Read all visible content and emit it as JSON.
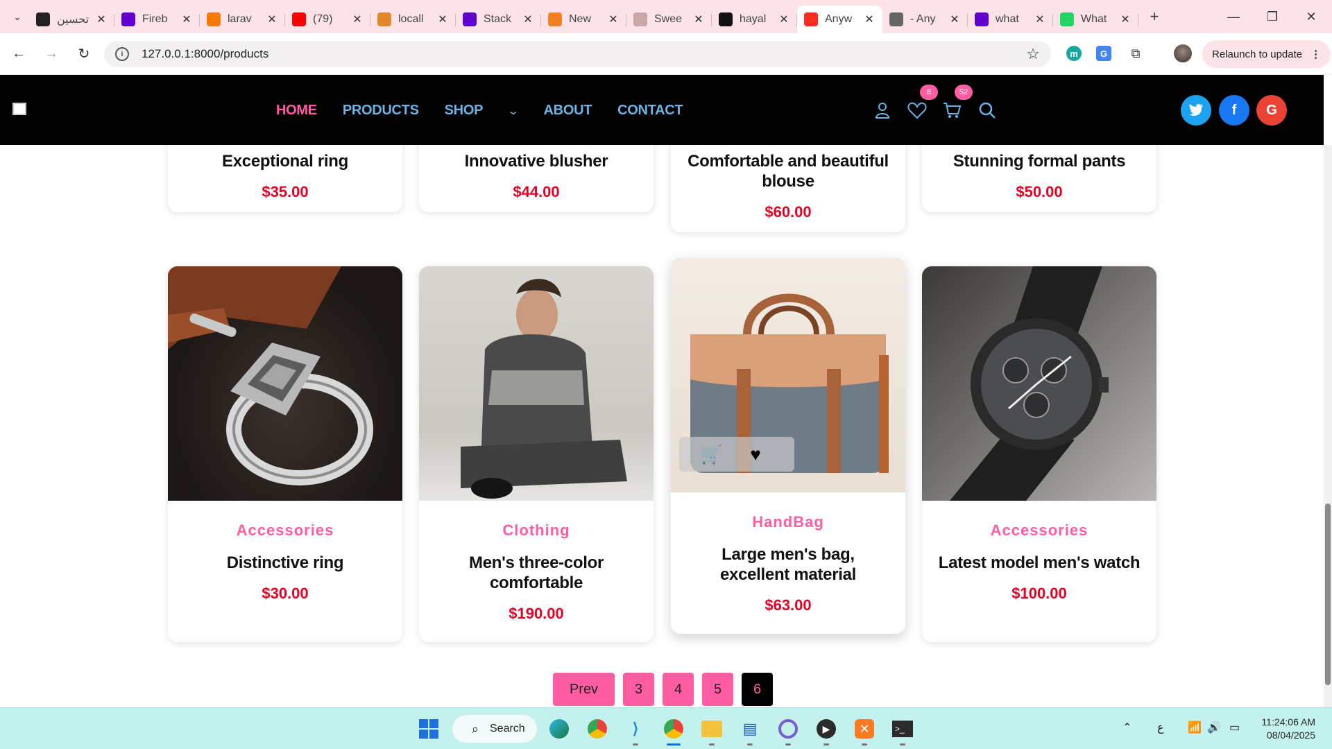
{
  "browser": {
    "tabs": [
      {
        "title": "تحسين",
        "icon": "openai-icon",
        "color": "#222"
      },
      {
        "title": "Fireb",
        "icon": "yahoo-icon",
        "color": "#6001d2"
      },
      {
        "title": "larav",
        "icon": "firebase-icon",
        "color": "#f57c00"
      },
      {
        "title": "(79)",
        "icon": "youtube-icon",
        "color": "#ff0000"
      },
      {
        "title": "locall",
        "icon": "phpmyadmin-icon",
        "color": "#e08a2c"
      },
      {
        "title": "Stack",
        "icon": "yahoo-icon",
        "color": "#6001d2"
      },
      {
        "title": "New",
        "icon": "stackoverflow-icon",
        "color": "#f48024"
      },
      {
        "title": "Swee",
        "icon": "sweetalert-icon",
        "color": "#c9a7a7"
      },
      {
        "title": "hayal",
        "icon": "github-icon",
        "color": "#111"
      },
      {
        "title": "Anyw",
        "icon": "laravel-icon",
        "color": "#ff2d20",
        "active": true
      },
      {
        "title": "- Any",
        "icon": "globe-icon",
        "color": "#666"
      },
      {
        "title": "what",
        "icon": "yahoo-icon",
        "color": "#6001d2"
      },
      {
        "title": "What",
        "icon": "whatsapp-icon",
        "color": "#25d366"
      }
    ],
    "url": "127.0.0.1:8000/products",
    "relaunch_label": "Relaunch to update"
  },
  "site": {
    "nav": [
      "HOME",
      "PRODUCTS",
      "SHOP",
      "ABOUT",
      "CONTACT"
    ],
    "wishlist_count": "8",
    "cart_count": "52",
    "colors": {
      "accent_pink": "#ff5da2",
      "nav_blue": "#6cb4e6",
      "price_red": "#e60023"
    }
  },
  "top_row": [
    {
      "name": "Exceptional ring",
      "price": "$35.00"
    },
    {
      "name": "Innovative blusher",
      "price": "$44.00"
    },
    {
      "name": "Comfortable and beautiful blouse",
      "price": "$60.00"
    },
    {
      "name": "Stunning formal pants",
      "price": "$50.00"
    }
  ],
  "products": [
    {
      "category": "Accessories",
      "name": "Distinctive ring",
      "price": "$30.00",
      "image": "ring"
    },
    {
      "category": "Clothing",
      "name": "Men's three-color comfortable",
      "price": "$190.00",
      "image": "hoodie"
    },
    {
      "category": "HandBag",
      "name": "Large men's bag, excellent material",
      "price": "$63.00",
      "image": "bag"
    },
    {
      "category": "Accessories",
      "name": "Latest model men's watch",
      "price": "$100.00",
      "image": "watch"
    }
  ],
  "pagination": {
    "prev": "Prev",
    "pages": [
      "3",
      "4",
      "5",
      "6"
    ],
    "current": "6"
  },
  "taskbar": {
    "search_label": "Search",
    "time": "11:24:06 AM",
    "date": "08/04/2025",
    "lang": "ع"
  }
}
